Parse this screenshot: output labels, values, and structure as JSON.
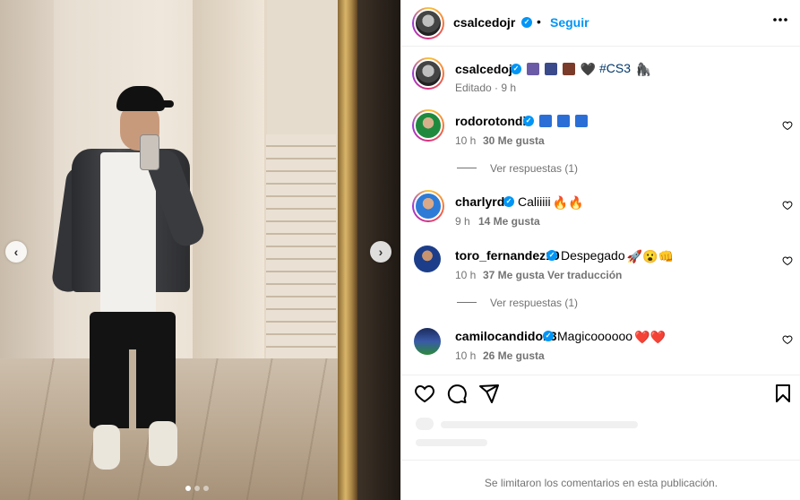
{
  "post": {
    "author": "csalcedojr",
    "follow_label": "Seguir",
    "more_label": "•••",
    "separator": "•",
    "caption": {
      "username": "csalcedojr",
      "text": "#CS3",
      "emoji_note": "🆔🧣🚂🖤",
      "trailing_emoji": "🦍",
      "meta": "Editado · 9 h"
    },
    "carousel": {
      "slides": 3,
      "current": 1
    }
  },
  "comments": [
    {
      "username": "rodorotondi",
      "text": "",
      "badges": [
        "top",
        "top",
        "top"
      ],
      "time": "10 h",
      "likes": "30 Me gusta",
      "replies": "Ver respuestas (1)"
    },
    {
      "username": "charlyrdz",
      "text": "Caliiiii",
      "emoji": "🔥🔥",
      "time": "9 h",
      "likes": "14 Me gusta"
    },
    {
      "username": "toro_fernandez19",
      "text": "Despegado",
      "emoji": "🚀😮👊",
      "time": "10 h",
      "likes": "37 Me gusta",
      "translate": "Ver traducción",
      "replies": "Ver respuestas (1)"
    },
    {
      "username": "camilocandido13",
      "text": "Magicoooooo",
      "emoji": "❤️❤️",
      "time": "10 h",
      "likes": "26 Me gusta"
    }
  ],
  "footer": {
    "text": "Se limitaron los comentarios en esta publicación."
  },
  "colors": {
    "accent": "#0095f6",
    "muted": "#737373",
    "border": "#efefef"
  },
  "icons": [
    "heart-icon",
    "comment-icon",
    "share-icon",
    "bookmark-icon",
    "more-icon",
    "chevron-left-icon",
    "chevron-right-icon"
  ]
}
